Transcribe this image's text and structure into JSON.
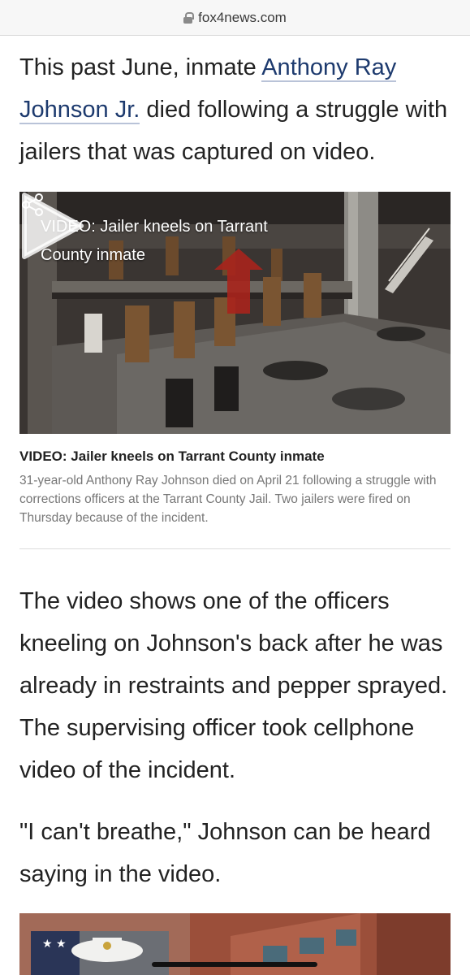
{
  "browser": {
    "domain": "fox4news.com",
    "lock_icon": "lock-icon"
  },
  "article": {
    "p1_before": "This past June, inmate ",
    "p1_link": "Anthony Ray Johnson Jr.",
    "p1_after": " died following a struggle with jailers that was captured on video.",
    "p2": "The video shows one of the officers kneeling on Johnson's back after he was already in restraints and pepper sprayed. The supervising officer took cellphone video of the incident.",
    "p3": "\"I can't breathe,\" Johnson can be heard saying in the video."
  },
  "video": {
    "overlay_title": "VIDEO: Jailer kneels on Tarrant County inmate",
    "share_icon": "share-icon",
    "play_icon": "play-icon",
    "caption_title": "VIDEO: Jailer kneels on Tarrant County inmate",
    "caption_text": "31-year-old Anthony Ray Johnson died on April 21 following a struggle with corrections officers at the Tarrant County Jail. Two jailers were fired on Thursday because of the incident."
  },
  "colors": {
    "link": "#1d3a6e",
    "link_underline": "#b9c3d8",
    "body_text": "#222222",
    "caption_text": "#777777",
    "arrow": "#a8241c"
  }
}
